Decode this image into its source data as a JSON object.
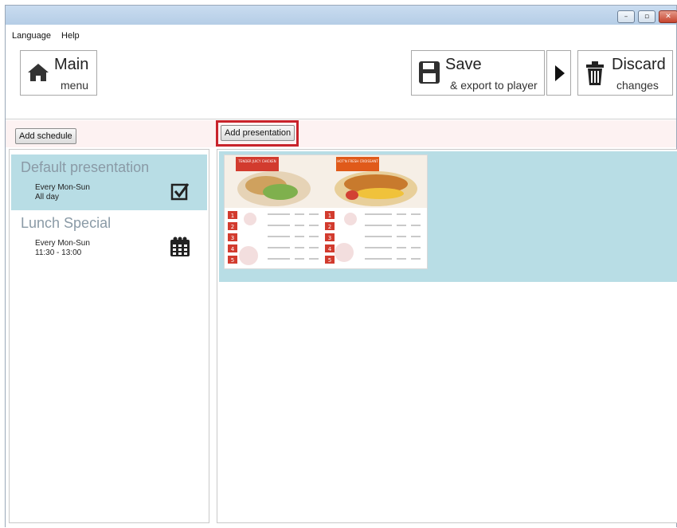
{
  "menu": {
    "language": "Language",
    "help": "Help"
  },
  "main_button": {
    "line1": "Main",
    "line2": "menu"
  },
  "save_button": {
    "line1": "Save",
    "line2": "& export to player"
  },
  "discard_button": {
    "line1": "Discard",
    "line2": "changes"
  },
  "add_schedule_label": "Add schedule",
  "add_presentation_label": "Add presentation",
  "schedules": [
    {
      "title": "Default presentation",
      "days": "Every Mon-Sun",
      "time": "All day",
      "icon": "checkbox-checked-icon",
      "selected": true
    },
    {
      "title": "Lunch Special",
      "days": "Every Mon-Sun",
      "time": "11:30 - 13:00",
      "icon": "calendar-icon",
      "selected": false
    }
  ],
  "thumbnail": {
    "tag_left": "TENDER JUICY CHICKEN",
    "tag_right": "HOT'N FRESH CROISSANT",
    "numbers": [
      "1",
      "2",
      "3",
      "4",
      "5"
    ]
  },
  "colors": {
    "selection": "#b8dde5",
    "highlight": "#c8232b",
    "menu_red": "#d23b2e"
  }
}
